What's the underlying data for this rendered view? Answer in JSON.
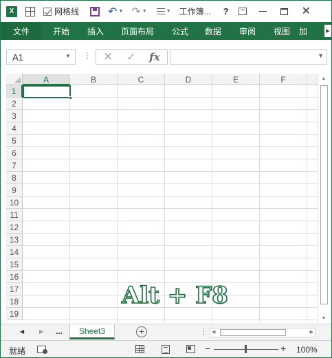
{
  "titlebar": {
    "gridlines_label": "网格线",
    "doc_title": "工作簿...",
    "help": "?",
    "close": "✕"
  },
  "ribbon": {
    "tabs": [
      "文件",
      "开始",
      "插入",
      "页面布局",
      "公式",
      "数据",
      "审阅",
      "视图",
      "加"
    ]
  },
  "formula_bar": {
    "name_box": "A1",
    "fx": "fx",
    "formula_value": ""
  },
  "sheet": {
    "columns": [
      "A",
      "B",
      "C",
      "D",
      "E",
      "F"
    ],
    "rows": [
      "1",
      "2",
      "3",
      "4",
      "5",
      "6",
      "7",
      "8",
      "9",
      "10",
      "11",
      "12",
      "13",
      "14",
      "15",
      "16",
      "17",
      "18",
      "19"
    ],
    "active_cell": "A1"
  },
  "sheet_tabs": {
    "more": "...",
    "active_tab": "Sheet3",
    "add": "+"
  },
  "status_bar": {
    "ready": "就绪",
    "zoom": "100%",
    "zoom_minus": "−",
    "zoom_plus": "+"
  },
  "overlay": {
    "shortcut": "Alt + F8"
  },
  "colors": {
    "accent": "#217346",
    "ribbon_bg": "#217346"
  }
}
